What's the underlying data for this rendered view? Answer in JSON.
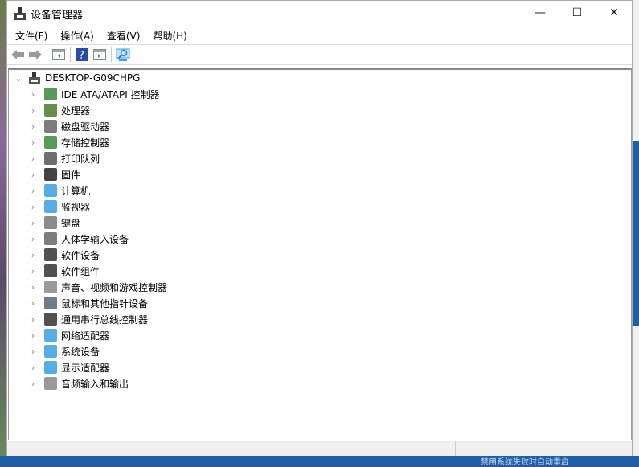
{
  "window": {
    "title": "设备管理器",
    "minimize": "—",
    "maximize": "☐",
    "close": "✕"
  },
  "menu": [
    {
      "label": "文件(F)"
    },
    {
      "label": "操作(A)"
    },
    {
      "label": "查看(V)"
    },
    {
      "label": "帮助(H)"
    }
  ],
  "toolbar": [
    "back",
    "forward",
    "show-hide-console-tree",
    "help",
    "action-pane",
    "scan-hardware"
  ],
  "tree": {
    "root": "DESKTOP-G09CHPG",
    "items": [
      {
        "label": "IDE ATA/ATAPI 控制器",
        "icon": "ide-controller-icon",
        "color": "#3a8a3a"
      },
      {
        "label": "处理器",
        "icon": "processor-icon",
        "color": "#4a7a2a"
      },
      {
        "label": "磁盘驱动器",
        "icon": "disk-drive-icon",
        "color": "#666666"
      },
      {
        "label": "存储控制器",
        "icon": "storage-controller-icon",
        "color": "#3a8a3a"
      },
      {
        "label": "打印队列",
        "icon": "printer-icon",
        "color": "#555555"
      },
      {
        "label": "固件",
        "icon": "firmware-icon",
        "color": "#222222"
      },
      {
        "label": "计算机",
        "icon": "computer-icon",
        "color": "#3aa0e0"
      },
      {
        "label": "监视器",
        "icon": "monitor-icon",
        "color": "#3aa0e0"
      },
      {
        "label": "键盘",
        "icon": "keyboard-icon",
        "color": "#777777"
      },
      {
        "label": "人体学输入设备",
        "icon": "hid-icon",
        "color": "#666666"
      },
      {
        "label": "软件设备",
        "icon": "software-device-icon",
        "color": "#333333"
      },
      {
        "label": "软件组件",
        "icon": "software-component-icon",
        "color": "#333333"
      },
      {
        "label": "声音、视频和游戏控制器",
        "icon": "speaker-icon",
        "color": "#888888"
      },
      {
        "label": "鼠标和其他指针设备",
        "icon": "mouse-icon",
        "color": "#556677"
      },
      {
        "label": "通用串行总线控制器",
        "icon": "usb-icon",
        "color": "#333333"
      },
      {
        "label": "网络适配器",
        "icon": "network-adapter-icon",
        "color": "#3aa0e0"
      },
      {
        "label": "系统设备",
        "icon": "system-device-icon",
        "color": "#3aa0e0"
      },
      {
        "label": "显示适配器",
        "icon": "display-adapter-icon",
        "color": "#3aa0e0"
      },
      {
        "label": "音频输入和输出",
        "icon": "audio-io-icon",
        "color": "#888888"
      }
    ]
  },
  "background": {
    "bottom_text": "禁用系统失败时自动重启"
  }
}
